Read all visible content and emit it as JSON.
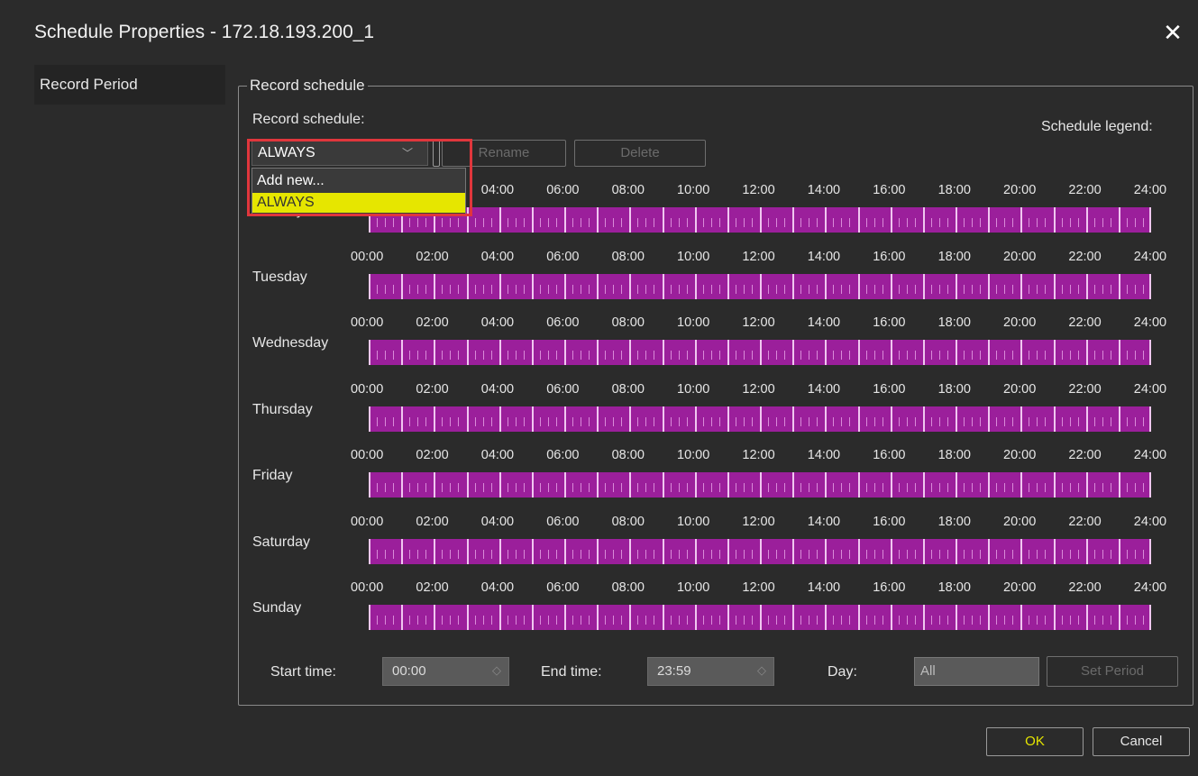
{
  "window": {
    "title": "Schedule Properties - 172.18.193.200_1",
    "close_glyph": "✕"
  },
  "sidebar": {
    "items": [
      {
        "label": "Record Period"
      }
    ]
  },
  "group": {
    "legend": "Record schedule"
  },
  "schedule": {
    "label": "Record schedule:",
    "legend_label": "Schedule legend:",
    "selected": "ALWAYS",
    "options": [
      "Add new...",
      "ALWAYS"
    ],
    "rename_label": "Rename",
    "delete_label": "Delete"
  },
  "timeline": {
    "ticks": [
      "00:00",
      "02:00",
      "04:00",
      "06:00",
      "08:00",
      "10:00",
      "12:00",
      "14:00",
      "16:00",
      "18:00",
      "20:00",
      "22:00",
      "24:00"
    ],
    "days": [
      "Monday",
      "Tuesday",
      "Wednesday",
      "Thursday",
      "Friday",
      "Saturday",
      "Sunday"
    ],
    "color": "#9b1f9b"
  },
  "period": {
    "start_label": "Start time:",
    "start_value": "00:00",
    "end_label": "End time:",
    "end_value": "23:59",
    "day_label": "Day:",
    "day_value": "All",
    "set_label": "Set Period"
  },
  "footer": {
    "ok_label": "OK",
    "cancel_label": "Cancel"
  },
  "colors": {
    "accent": "#e6e600",
    "highlight": "#e0363c",
    "background": "#2b2b2b"
  }
}
